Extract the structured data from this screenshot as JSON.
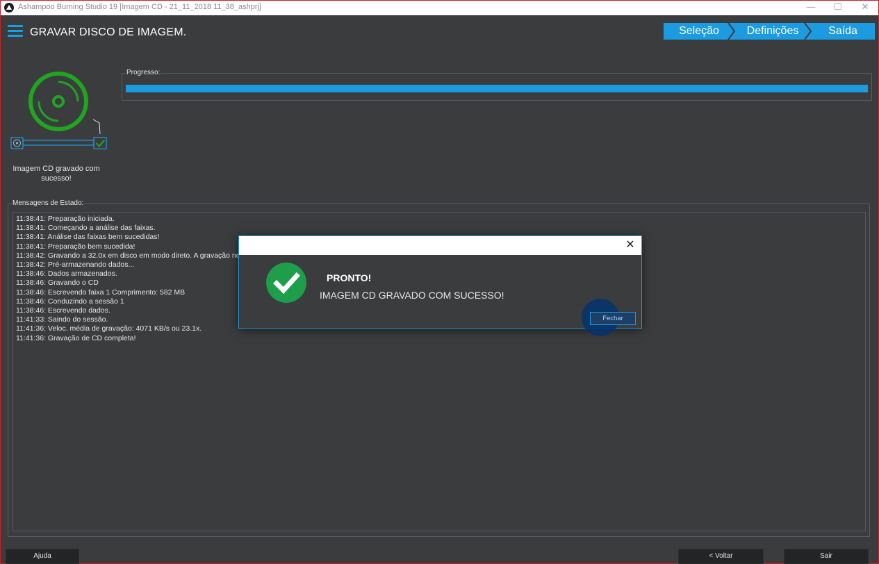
{
  "titlebar": {
    "title": "Ashampoo Burning Studio 19 [Imagem CD  - 21_11_2018 11_38_ashprj]",
    "minimize": "—",
    "maximize": "☐",
    "close": "✕"
  },
  "header": {
    "title": "GRAVAR DISCO DE IMAGEM.",
    "steps": [
      "Seleção",
      "Definições",
      "Saída"
    ]
  },
  "status": {
    "caption": "Imagem CD  gravado com sucesso!"
  },
  "progress": {
    "label": "Progresso:",
    "value": 1.0
  },
  "messages": {
    "label": "Mensagens de Estado:",
    "lines": [
      "11:38:41: Preparação iniciada.",
      "11:38:41: Começando a análise das faixas.",
      "11:38:41: Análise das faixas bem sucedidas!",
      "11:38:41: Preparação bem sucedida!",
      "11:38:42: Gravando a 32.0x em disco em modo direto. A gravação no C",
      "11:38:42: Pré-armazenando dados...",
      "11:38:46: Dados armazenados.",
      "11:38:46: Gravando o CD",
      "11:38:46: Escrevendo faixa 1 Comprimento: 582 MB",
      "11:38:46: Conduzindo a sessão 1",
      "11:38:46: Escrevendo dados.",
      "11:41:33: Saindo do sessão.",
      "11:41:36: Veloc. média de gravação: 4071 KB/s ou 23.1x.",
      "11:41:36: Gravação de CD completa!"
    ]
  },
  "footer": {
    "help": "Ajuda",
    "back": "< Voltar",
    "exit": "Sair"
  },
  "dialog": {
    "close": "✕",
    "heading": "PRONTO!",
    "message": "IMAGEM CD  GRAVADO COM SUCESSO!",
    "button": "Fechar"
  },
  "colors": {
    "accent": "#1d9be0",
    "success": "#1fa51f",
    "window_border": "#c8202a"
  }
}
